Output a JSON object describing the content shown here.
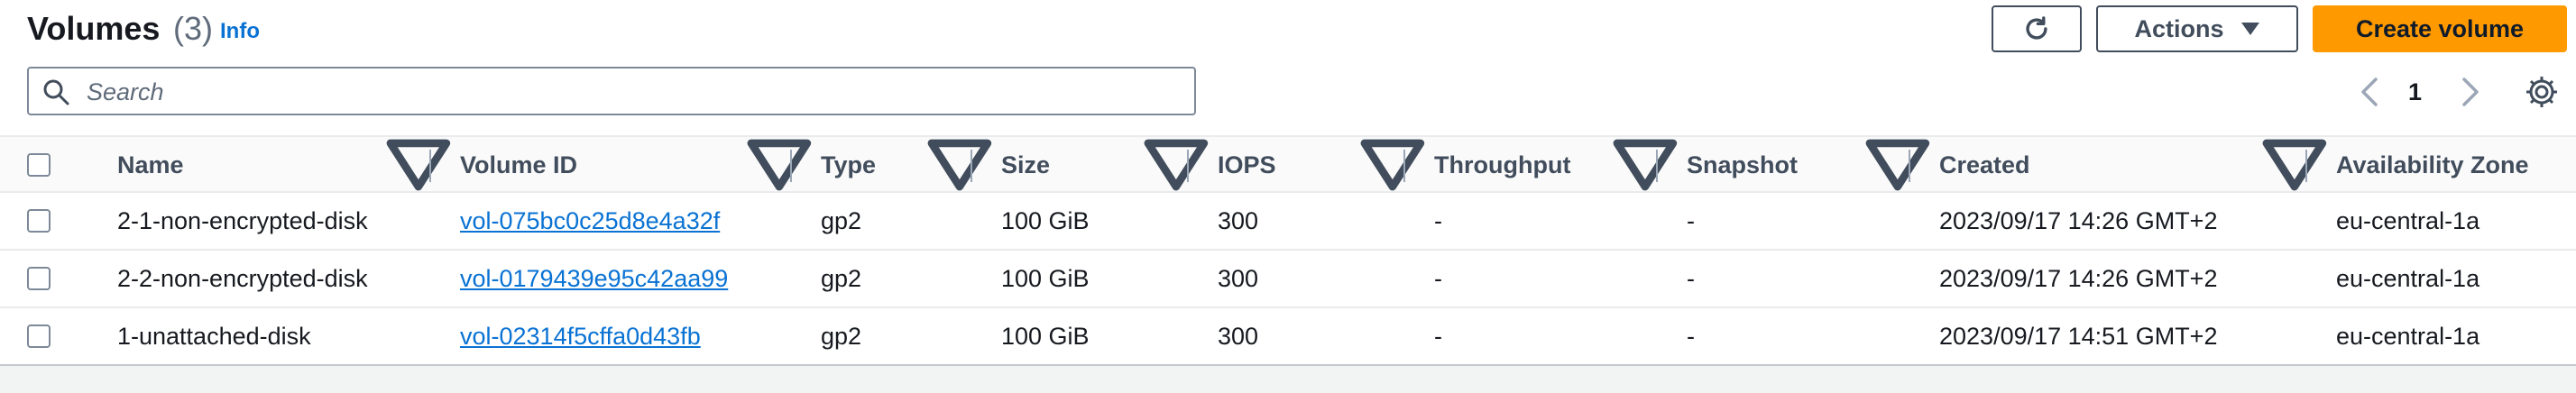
{
  "header": {
    "title": "Volumes",
    "count": "(3)",
    "info_label": "Info"
  },
  "toolbar": {
    "refresh_icon": "refresh-icon",
    "actions_label": "Actions",
    "create_label": "Create volume",
    "create_color": "#ff9900"
  },
  "search": {
    "placeholder": "Search",
    "value": ""
  },
  "pagination": {
    "current_page": "1"
  },
  "table": {
    "columns": [
      "Name",
      "Volume ID",
      "Type",
      "Size",
      "IOPS",
      "Throughput",
      "Snapshot",
      "Created",
      "Availability Zone"
    ],
    "rows": [
      {
        "name": "2-1-non-encrypted-disk",
        "volume_id": "vol-075bc0c25d8e4a32f",
        "type": "gp2",
        "size": "100 GiB",
        "iops": "300",
        "throughput": "-",
        "snapshot": "-",
        "created": "2023/09/17 14:26 GMT+2",
        "zone": "eu-central-1a"
      },
      {
        "name": "2-2-non-encrypted-disk",
        "volume_id": "vol-0179439e95c42aa99",
        "type": "gp2",
        "size": "100 GiB",
        "iops": "300",
        "throughput": "-",
        "snapshot": "-",
        "created": "2023/09/17 14:26 GMT+2",
        "zone": "eu-central-1a"
      },
      {
        "name": "1-unattached-disk",
        "volume_id": "vol-02314f5cffa0d43fb",
        "type": "gp2",
        "size": "100 GiB",
        "iops": "300",
        "throughput": "-",
        "snapshot": "-",
        "created": "2023/09/17 14:51 GMT+2",
        "zone": "eu-central-1a"
      }
    ]
  },
  "colors": {
    "link": "#0972d3",
    "text": "#16191f",
    "border": "#7d8998"
  }
}
